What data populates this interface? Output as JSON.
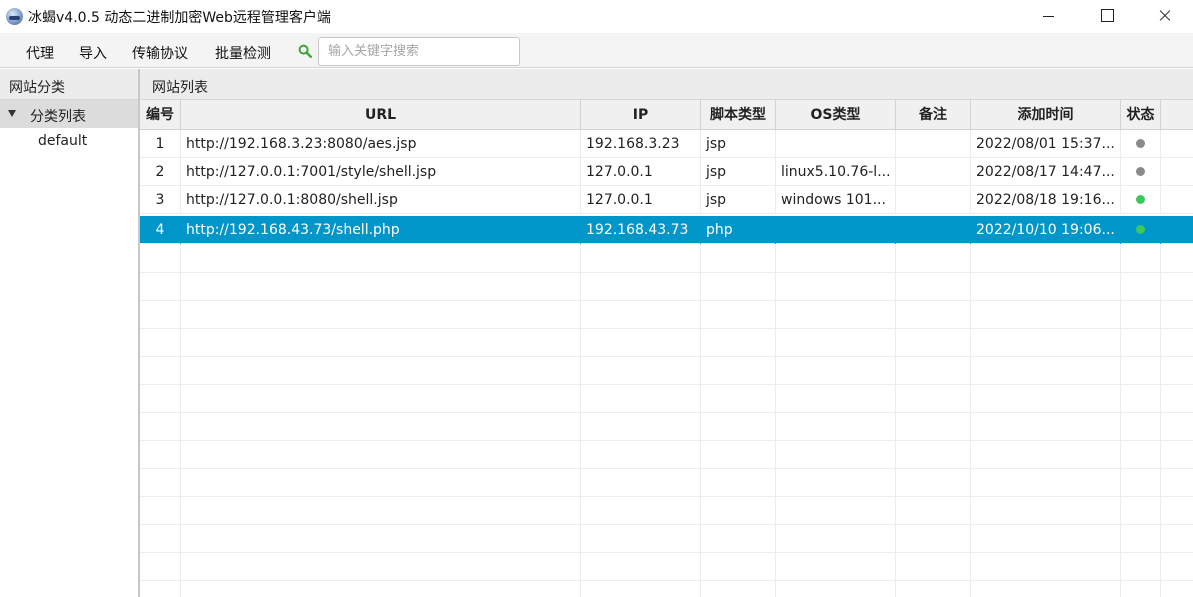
{
  "window": {
    "title": "冰蝎v4.0.5 动态二进制加密Web远程管理客户端"
  },
  "menubar": {
    "items": [
      "代理",
      "导入",
      "传输协议",
      "批量检测"
    ],
    "search": {
      "placeholder": "输入关键字搜索",
      "value": ""
    }
  },
  "left_panel": {
    "header": "网站分类",
    "tree": {
      "root_label": "分类列表",
      "children": [
        "default"
      ]
    }
  },
  "main": {
    "header": "网站列表",
    "columns": [
      "编号",
      "URL",
      "IP",
      "脚本类型",
      "OS类型",
      "备注",
      "添加时间",
      "状态"
    ],
    "rows": [
      {
        "id": "1",
        "url": "http://192.168.3.23:8080/aes.jsp",
        "ip": "192.168.3.23",
        "script": "jsp",
        "os": "",
        "note": "",
        "time": "2022/08/01 15:37...",
        "status_color": "#8a8a8a"
      },
      {
        "id": "2",
        "url": "http://127.0.0.1:7001/style/shell.jsp",
        "ip": "127.0.0.1",
        "script": "jsp",
        "os": "linux5.10.76-l...",
        "note": "",
        "time": "2022/08/17 14:47...",
        "status_color": "#8a8a8a"
      },
      {
        "id": "3",
        "url": "http://127.0.0.1:8080/shell.jsp",
        "ip": "127.0.0.1",
        "script": "jsp",
        "os": "windows 101...",
        "note": "",
        "time": "2022/08/18 19:16...",
        "status_color": "#3cc85a"
      },
      {
        "id": "4",
        "url": "http://192.168.43.73/shell.php",
        "ip": "192.168.43.73",
        "script": "php",
        "os": "",
        "note": "",
        "time": "2022/10/10 19:06...",
        "status_color": "#3cc85a",
        "selected": true
      }
    ]
  },
  "colors": {
    "selection": "#0096c9",
    "status_online": "#3cc85a",
    "status_unknown": "#8a8a8a",
    "search_icon": "#3aa53a"
  }
}
